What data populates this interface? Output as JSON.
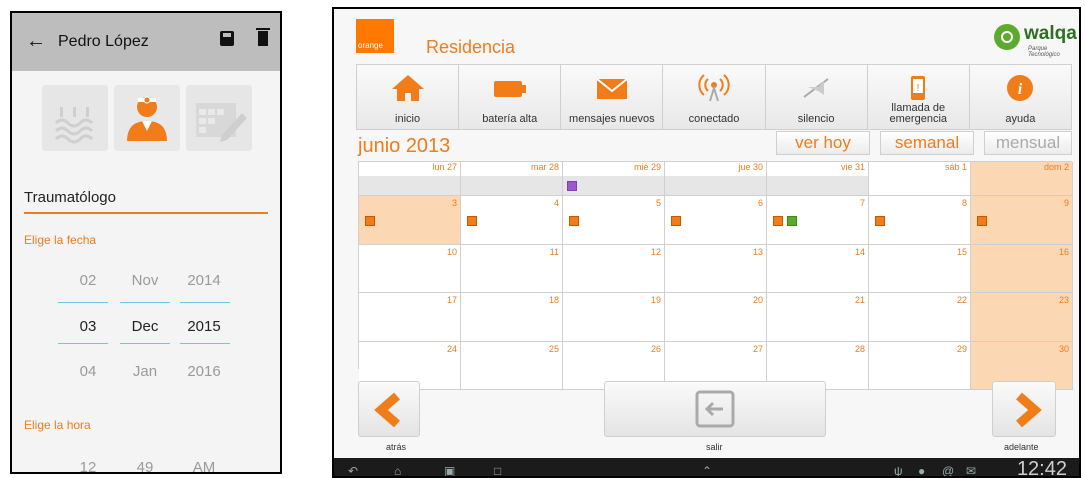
{
  "phone": {
    "title": "Pedro López",
    "specialty": "Traumatólogo",
    "date_label": "Elige la fecha",
    "time_label": "Elige la hora",
    "date_rows": [
      [
        "02",
        "Nov",
        "2014"
      ],
      [
        "03",
        "Dec",
        "2015"
      ],
      [
        "04",
        "Jan",
        "2016"
      ]
    ],
    "time_row": [
      "12",
      "49",
      "AM"
    ]
  },
  "tablet": {
    "brand": "orange",
    "app_title": "Residencia",
    "partner_logo": "walqa",
    "partner_sub": "Parque Tecnológico",
    "toolbar": [
      {
        "label": "inicio",
        "icon": "house-icon",
        "color": "#f07c1a"
      },
      {
        "label": "batería alta",
        "icon": "battery-icon",
        "color": "#f07c1a"
      },
      {
        "label": "mensajes nuevos",
        "icon": "envelope-icon",
        "color": "#f07c1a"
      },
      {
        "label": "conectado",
        "icon": "antenna-icon",
        "color": "#f07c1a"
      },
      {
        "label": "silencio",
        "icon": "mute-icon",
        "color": "#999999"
      },
      {
        "label": "llamada de emergencia",
        "icon": "phone-alert-icon",
        "color": "#f07c1a"
      },
      {
        "label": "ayuda",
        "icon": "info-icon",
        "color": "#f07c1a"
      }
    ],
    "month": "junio 2013",
    "view_buttons": {
      "today": "ver hoy",
      "weekly": "semanal",
      "monthly": "mensual"
    },
    "weekday_headers": [
      "lun 27",
      "mar 28",
      "mié 29",
      "jue 30",
      "vie 31",
      "sáb 1",
      "dom 2"
    ],
    "weeks": [
      [
        "3",
        "4",
        "5",
        "6",
        "7",
        "8",
        "9"
      ],
      [
        "10",
        "11",
        "12",
        "13",
        "14",
        "15",
        "16"
      ],
      [
        "17",
        "18",
        "19",
        "20",
        "21",
        "22",
        "23"
      ],
      [
        "24",
        "25",
        "26",
        "27",
        "28",
        "29",
        "30"
      ]
    ],
    "nav": {
      "back": "atrás",
      "exit": "salir",
      "forward": "adelante"
    },
    "clock": "12:42"
  }
}
